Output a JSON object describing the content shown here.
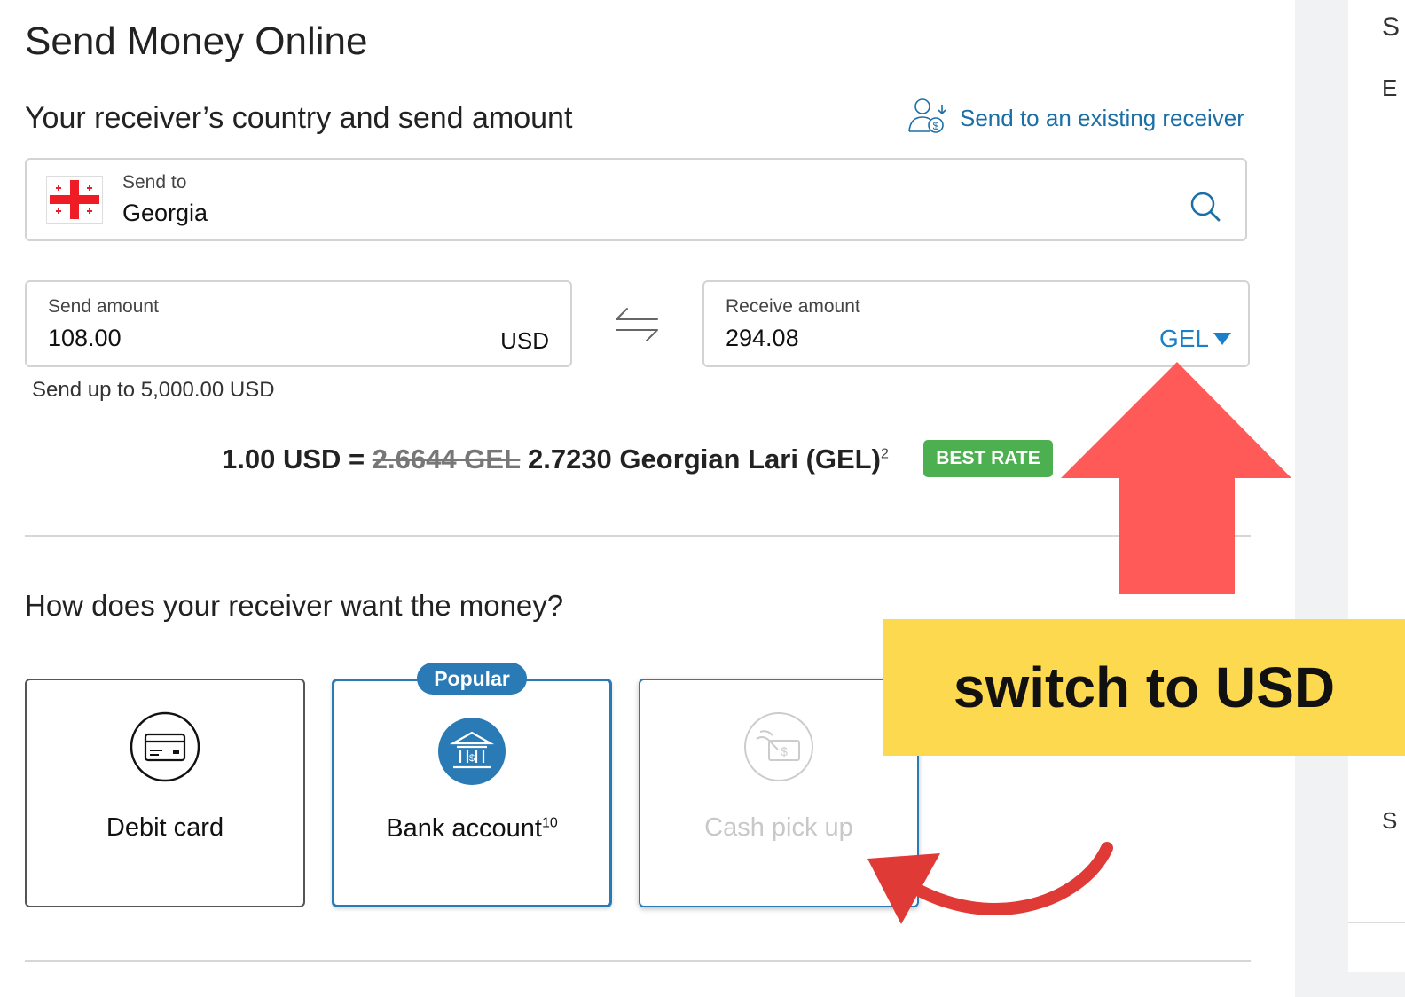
{
  "header": {
    "title": "Send Money Online"
  },
  "country_section": {
    "title": "Your receiver’s country and send amount",
    "existing_receiver_link": "Send to an existing receiver",
    "send_to_label": "Send to",
    "country": "Georgia"
  },
  "send_amount": {
    "label": "Send amount",
    "value": "108.00",
    "currency": "USD"
  },
  "receive_amount": {
    "label": "Receive amount",
    "value": "294.08",
    "currency": "GEL"
  },
  "limit_text": "Send up to 5,000.00 USD",
  "rate": {
    "prefix": "1.00 USD =",
    "old_rate": "2.6644 GEL",
    "new_rate": "2.7230 Georgian Lari (GEL)",
    "footnote": "2",
    "badge": "BEST RATE"
  },
  "delivery": {
    "question": "How does your receiver want the money?",
    "popular_badge": "Popular",
    "options": [
      {
        "label": "Debit card",
        "sup": ""
      },
      {
        "label": "Bank account",
        "sup": "10"
      },
      {
        "label": "Cash pick up",
        "sup": ""
      }
    ]
  },
  "right_panel": {
    "letters": [
      "S",
      "E",
      "S"
    ]
  },
  "annotation": {
    "callout": "switch to USD"
  },
  "colors": {
    "accent": "#1a80c9",
    "link": "#1a6fa6",
    "best_rate": "#4caf50",
    "option_border": "#2a7ab5",
    "annotation_arrow": "#ff5a57",
    "annotation_curve": "#e03a36",
    "callout_bg": "#fdd94f"
  }
}
